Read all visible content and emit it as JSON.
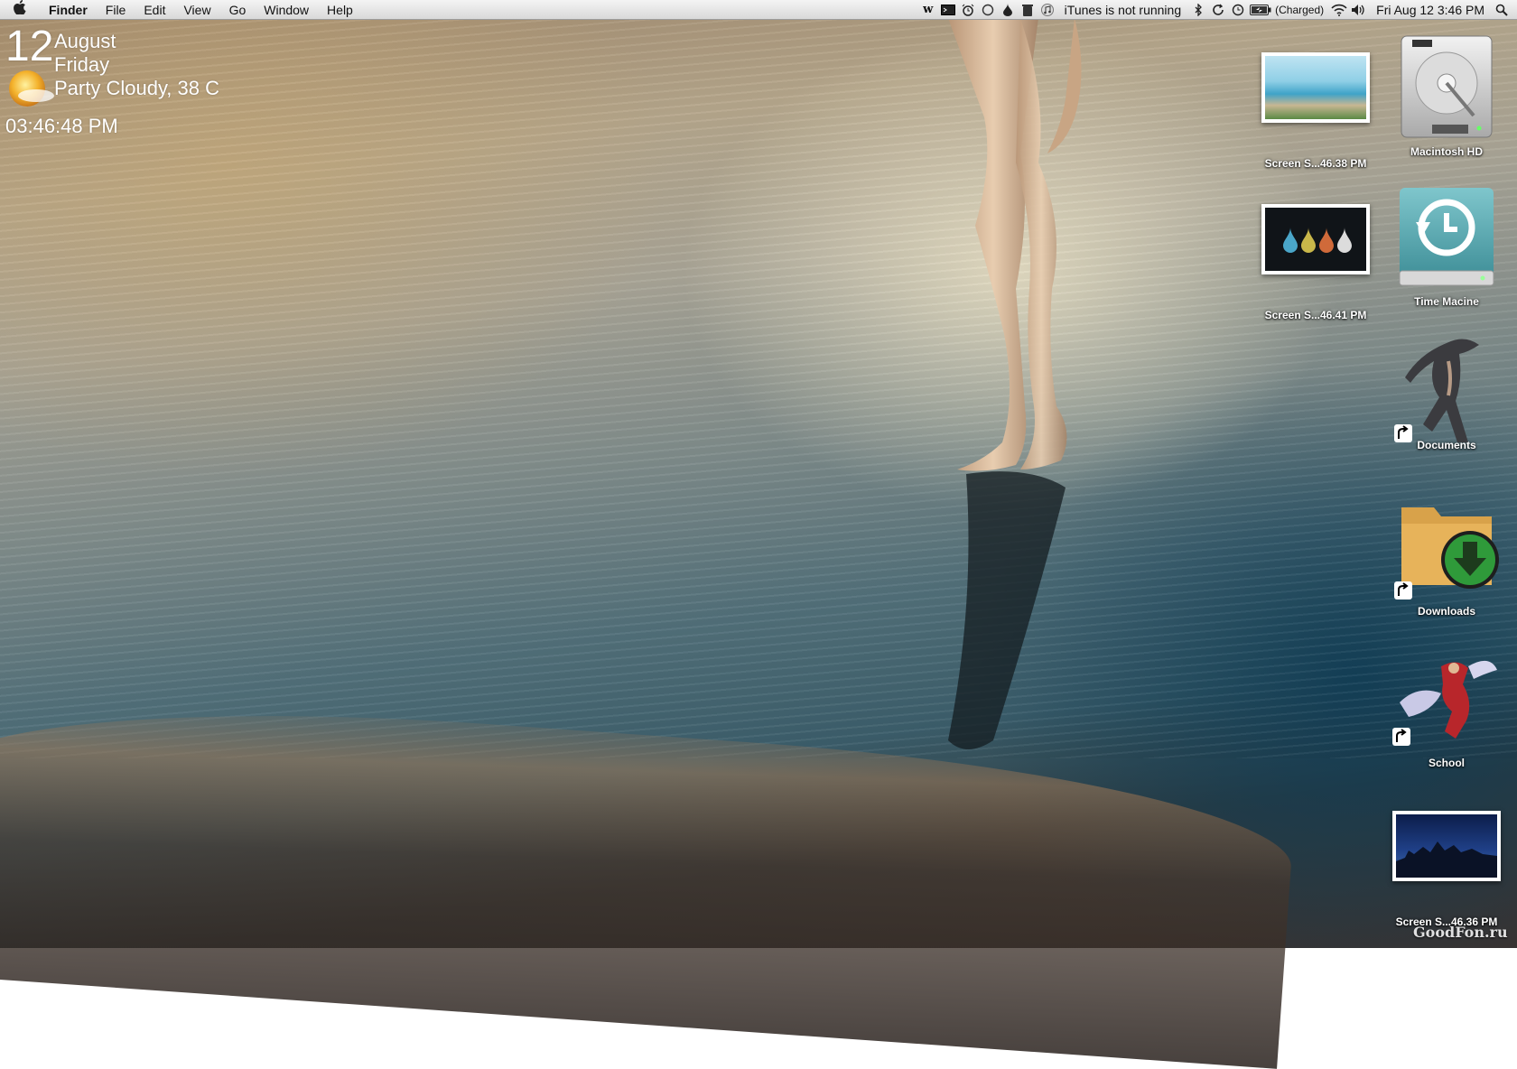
{
  "menubar": {
    "app_name": "Finder",
    "menus": [
      "File",
      "Edit",
      "View",
      "Go",
      "Window",
      "Help"
    ],
    "status": {
      "itunes": "iTunes is not running",
      "battery": "(Charged)",
      "clock": "Fri Aug 12  3:46 PM"
    }
  },
  "widget": {
    "day": "12",
    "month": "August",
    "weekday": "Friday",
    "weather": "Party Cloudy, 38 C",
    "time": "03:46:48 PM"
  },
  "desktop_icons": [
    {
      "label": "Screen S...46.38 PM",
      "icon": "screenshot-thumbnail"
    },
    {
      "label": "Macintosh HD",
      "icon": "hard-drive-icon"
    },
    {
      "label": "Screen S...46.41 PM",
      "icon": "screenshot-thumbnail"
    },
    {
      "label": "Time Macine",
      "icon": "time-machine-icon"
    },
    {
      "label": "Documents",
      "icon": "character-alias-icon"
    },
    {
      "label": "Downloads",
      "icon": "downloads-folder-icon"
    },
    {
      "label": "School",
      "icon": "character-alias-icon"
    },
    {
      "label": "Screen S...46.36 PM",
      "icon": "screenshot-thumbnail"
    }
  ],
  "watermark": "GoodFon.ru",
  "colors": {
    "menubar_bg": "#e6e6e6",
    "label_text": "#ffffff",
    "time_machine": "#5fa9b0",
    "downloads_green": "#2f9a3a"
  }
}
